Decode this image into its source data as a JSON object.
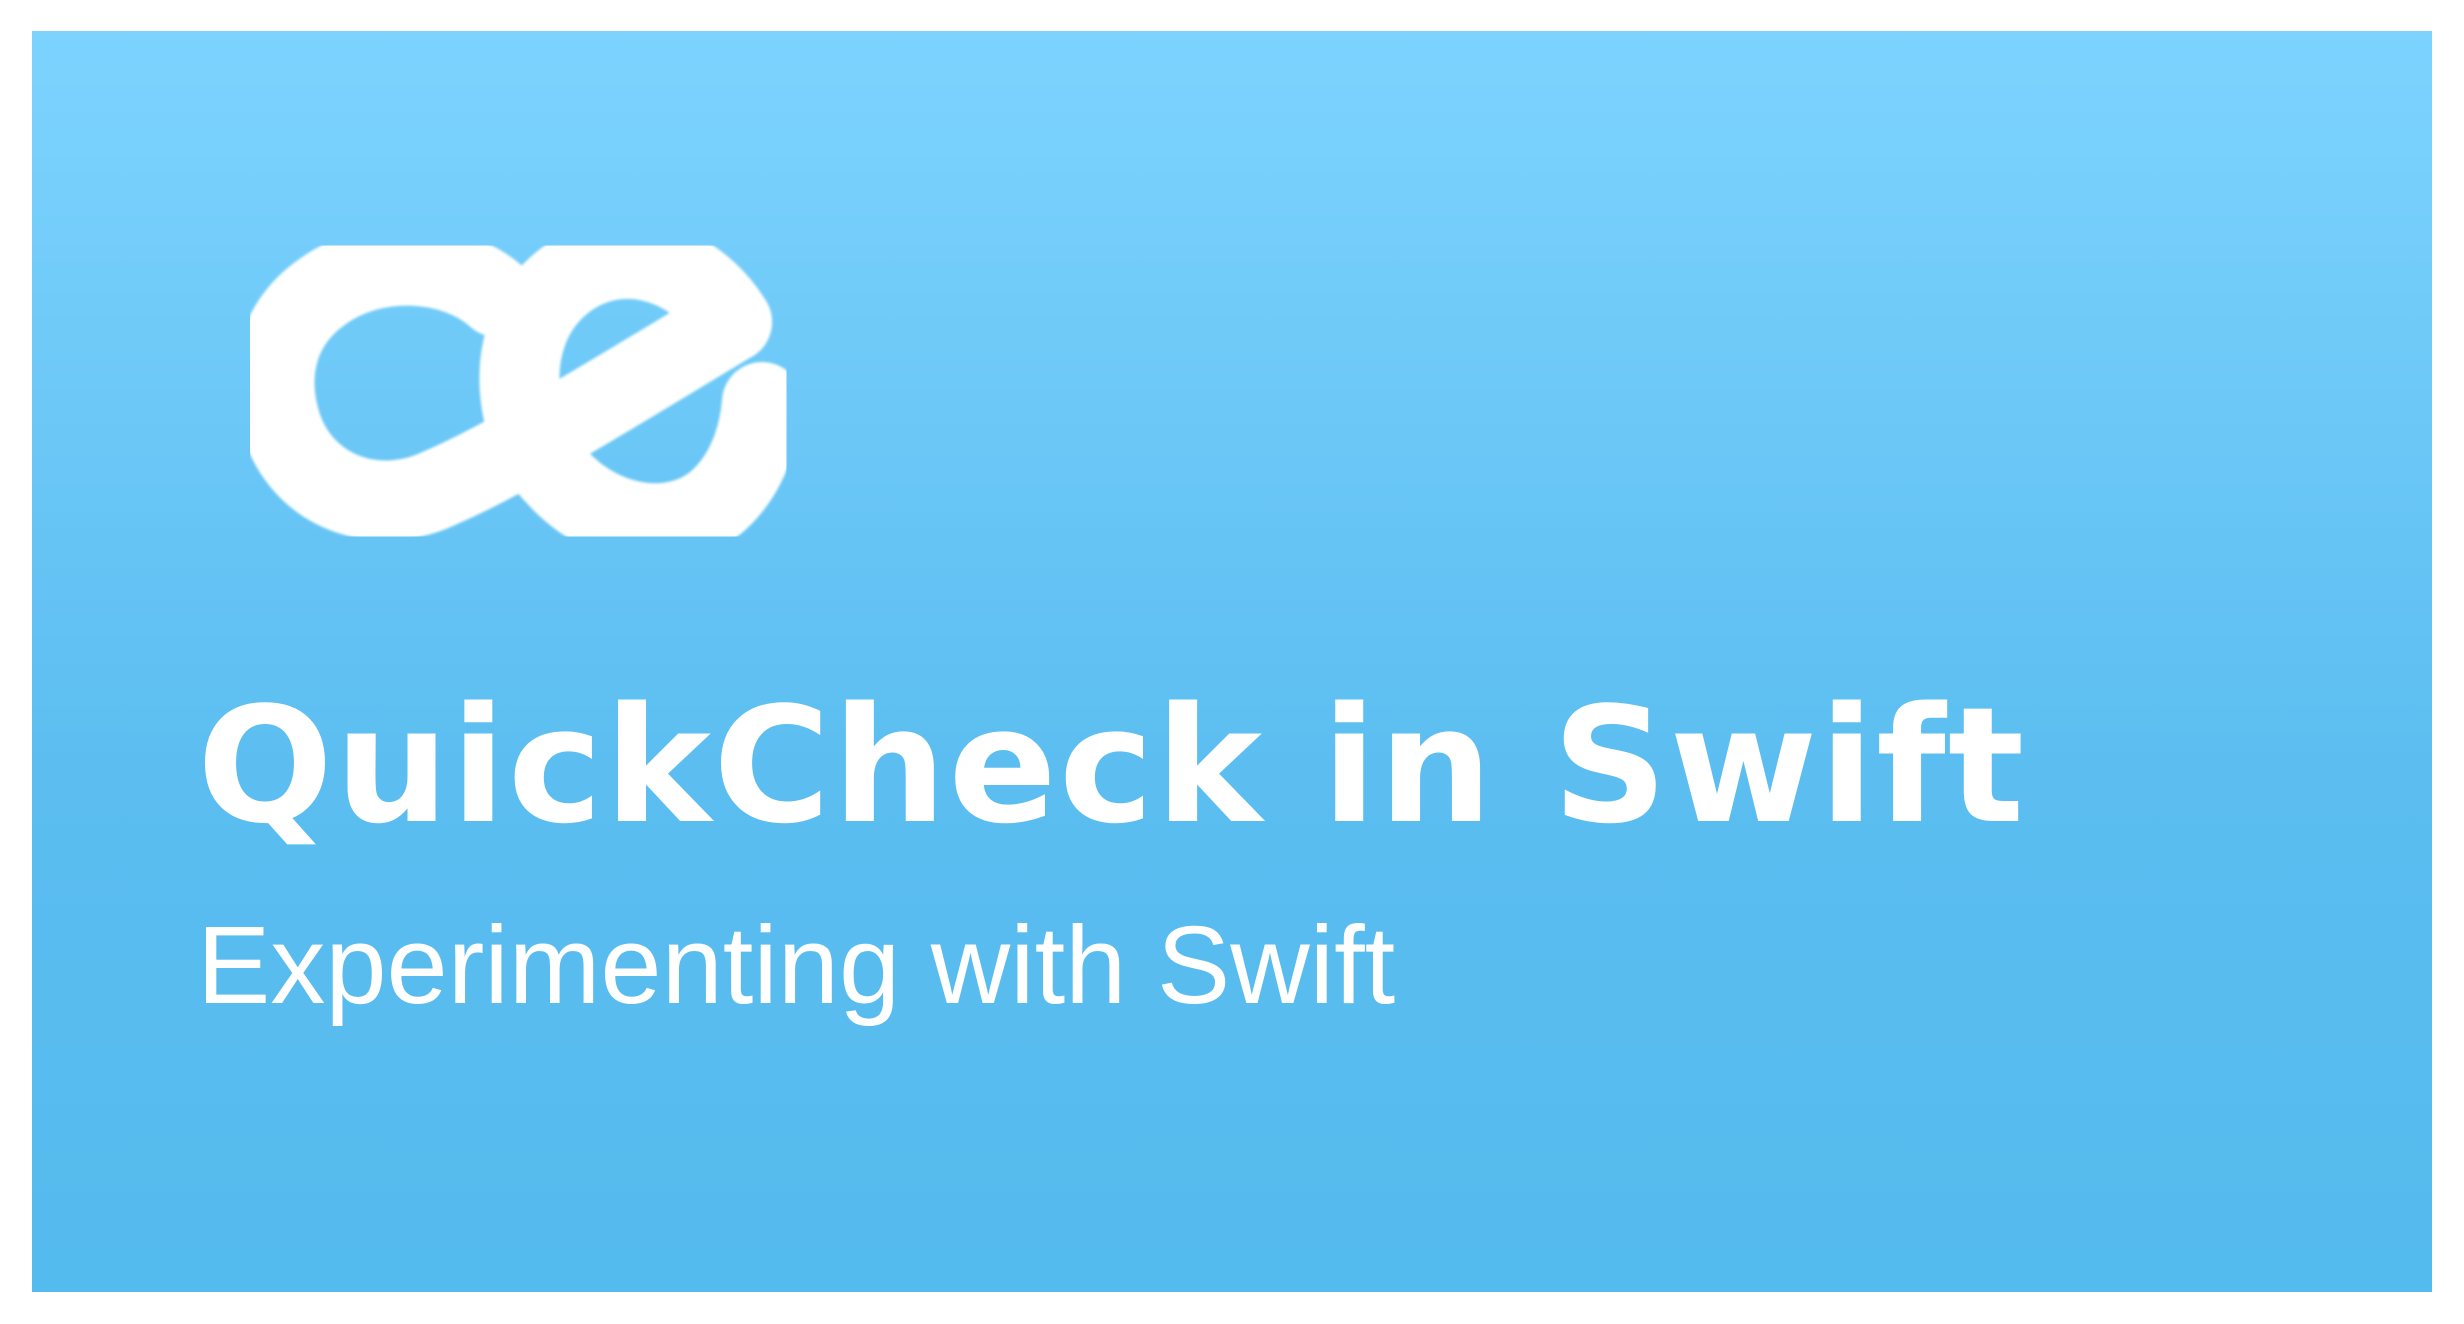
{
  "card": {
    "background_top": "#7dd3fe",
    "background_bottom": "#54bbee",
    "text_color": "#ffffff"
  },
  "logo": {
    "icon": "ce-logo-icon",
    "color": "#ffffff"
  },
  "title": "QuickCheck in Swift",
  "subtitle": "Experimenting with Swift"
}
